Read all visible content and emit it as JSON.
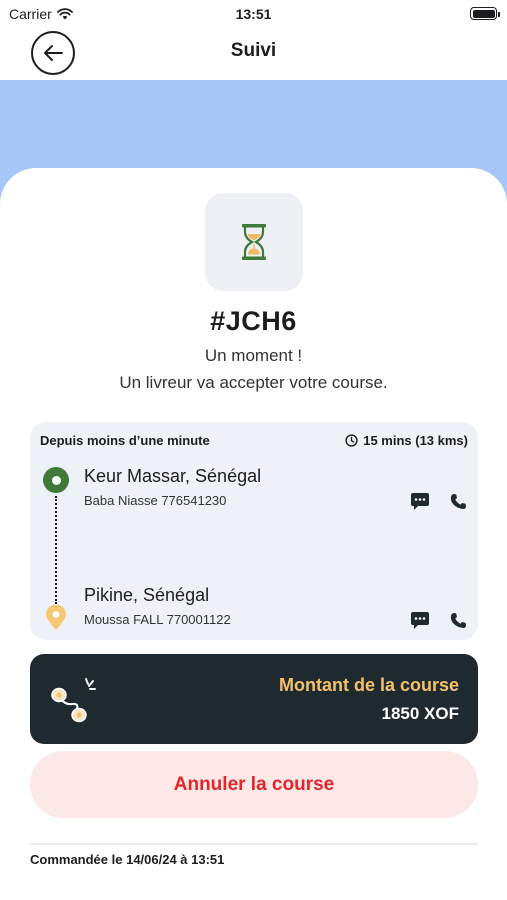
{
  "status_bar": {
    "carrier": "Carrier",
    "time": "13:51"
  },
  "nav": {
    "title": "Suivi"
  },
  "order": {
    "code": "#JCH6",
    "message_line1": "Un moment !",
    "message_line2": "Un livreur va accepter votre course."
  },
  "route": {
    "since": "Depuis moins d’une minute",
    "eta": "15 mins (13 kms)",
    "pickup": {
      "place": "Keur Massar, Sénégal",
      "contact": "Baba Niasse 776541230"
    },
    "dropoff": {
      "place": "Pikine, Sénégal",
      "contact": "Moussa FALL 770001122"
    }
  },
  "amount": {
    "label": "Montant de la course",
    "value": "1850 XOF"
  },
  "cancel_label": "Annuler la course",
  "ordered_at": "Commandée le 14/06/24 à 13:51",
  "colors": {
    "header_band": "#a6c6f7",
    "pickup_pin": "#3f7a39",
    "dropoff_pin": "#f7c873",
    "amount_bg": "#1f2a30",
    "amount_label": "#f5c26b",
    "cancel_bg": "#fde8e8",
    "cancel_text": "#e3262b"
  },
  "icons": {
    "back": "arrow-left-icon",
    "status": "hourglass-icon",
    "eta": "clock-icon",
    "chat": "chat-bubble-icon",
    "phone": "phone-icon",
    "amount": "route-coins-icon",
    "wifi": "wifi-icon",
    "battery": "battery-icon"
  }
}
